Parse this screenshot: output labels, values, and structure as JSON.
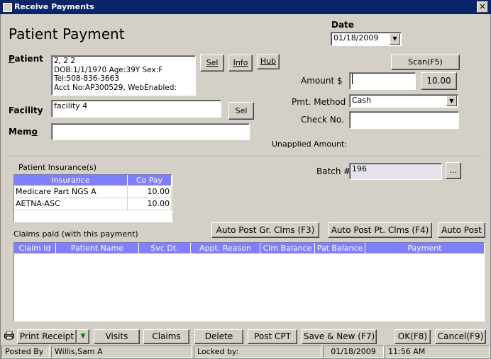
{
  "window": {
    "title": "Receive Payments",
    "close_label": "✕"
  },
  "page_title": "Patient Payment",
  "date": {
    "label": "Date",
    "value": "01/18/2009"
  },
  "patient": {
    "label": "Patient",
    "lines": [
      "2, 2 2",
      "DOB:1/1/1970  Age:39Y  Sex:F",
      "Tel:508-836-3663",
      "Acct No:AP300529, WebEnabled:"
    ],
    "sel_label": "Sel",
    "info_label": "Info",
    "hub_label": "Hub"
  },
  "facility": {
    "label": "Facility",
    "value": "facility 4",
    "sel_label": "Sel"
  },
  "memo": {
    "label": "Memo",
    "value": ""
  },
  "scan_label": "Scan(F5)",
  "amount": {
    "label": "Amount $",
    "value": "",
    "button_label": "10.00"
  },
  "pmt_method": {
    "label": "Pmt. Method",
    "value": "Cash"
  },
  "check_no": {
    "label": "Check No.",
    "value": ""
  },
  "unapplied": {
    "label": "Unapplied Amount:",
    "value": ""
  },
  "insurance": {
    "label": "Patient Insurance(s)",
    "columns": [
      "Insurance",
      "Co Pay"
    ],
    "rows": [
      {
        "name": "Medicare Part NGS A",
        "copay": "10.00"
      },
      {
        "name": "AETNA-ASC",
        "copay": "10.00"
      }
    ]
  },
  "batch": {
    "label": "Batch #",
    "value": "196",
    "browse_label": "..."
  },
  "auto_post": {
    "gr_label": "Auto Post Gr. Clms (F3)",
    "pt_label": "Auto Post Pt. Clms (F4)",
    "auto_label": "Auto Post"
  },
  "claims": {
    "label": "Claims paid (with this payment)",
    "columns": [
      "Claim Id",
      "Patient Name",
      "Svc Dt.",
      "Appt. Reason",
      "Clm Balance",
      "Pat Balance",
      "Payment"
    ]
  },
  "buttons": {
    "print_receipt": "Print Receipt",
    "visits": "Visits",
    "claims": "Claims",
    "delete": "Delete",
    "post_cpt": "Post CPT",
    "save_new": "Save & New (F7)",
    "ok": "OK(F8)",
    "cancel": "Cancel(F9)"
  },
  "status": {
    "posted_by_label": "Posted By",
    "posted_by_value": "Willis,Sam A",
    "locked_by_label": "Locked by:",
    "date": "01/18/2009",
    "time": "11:56 AM"
  },
  "colors": {
    "titlebar": "#0a246a",
    "grid_header": "#8080ff",
    "face": "#d4d0c8"
  }
}
